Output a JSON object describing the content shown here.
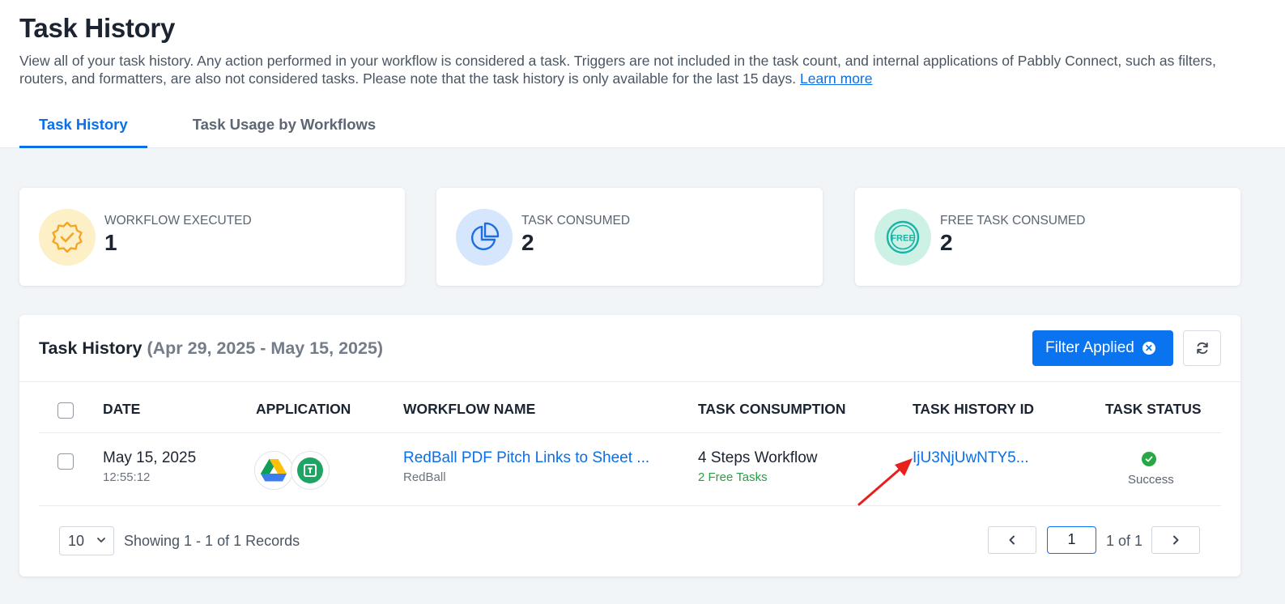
{
  "header": {
    "title": "Task History",
    "description": "View all of your task history. Any action performed in your workflow is considered a task. Triggers are not included in the task count, and internal applications of Pabbly Connect, such as filters, routers, and formatters, are also not considered tasks. Please note that the task history is only available for the last 15 days.",
    "learn_more": "Learn more"
  },
  "tabs": [
    {
      "label": "Task History",
      "active": true
    },
    {
      "label": "Task Usage by Workflows",
      "active": false
    }
  ],
  "stats": [
    {
      "label": "WORKFLOW EXECUTED",
      "value": "1",
      "icon": "badge-check-icon",
      "bg": "#fdefc6",
      "color": "#f4a523"
    },
    {
      "label": "TASK CONSUMED",
      "value": "2",
      "icon": "pie-chart-icon",
      "bg": "#d6e6fc",
      "color": "#1b6fe0"
    },
    {
      "label": "FREE TASK CONSUMED",
      "value": "2",
      "icon": "free-badge-icon",
      "bg": "#cdf2e5",
      "color": "#19b3a8"
    }
  ],
  "panel": {
    "title": "Task History",
    "range": "(Apr 29, 2025 - May 15, 2025)",
    "filter_label": "Filter Applied"
  },
  "table": {
    "columns": [
      "DATE",
      "APPLICATION",
      "WORKFLOW NAME",
      "TASK CONSUMPTION",
      "TASK HISTORY ID",
      "TASK STATUS"
    ],
    "rows": [
      {
        "date": "May 15, 2025",
        "time": "12:55:12",
        "apps": [
          "google-drive-icon",
          "pdf-tool-icon"
        ],
        "workflow_name": "RedBall PDF Pitch Links to Sheet ...",
        "workflow_folder": "RedBall",
        "consumption": "4 Steps Workflow",
        "free_tasks": "2 Free Tasks",
        "history_id": "IjU3NjUwNTY5...",
        "status": "Success"
      }
    ]
  },
  "pagination": {
    "per_page": "10",
    "showing": "Showing 1 - 1 of 1 Records",
    "page": "1",
    "of_text": "1 of 1"
  },
  "colors": {
    "accent": "#0a73f0",
    "success": "#28a745",
    "annotation_arrow": "#e8201c"
  }
}
